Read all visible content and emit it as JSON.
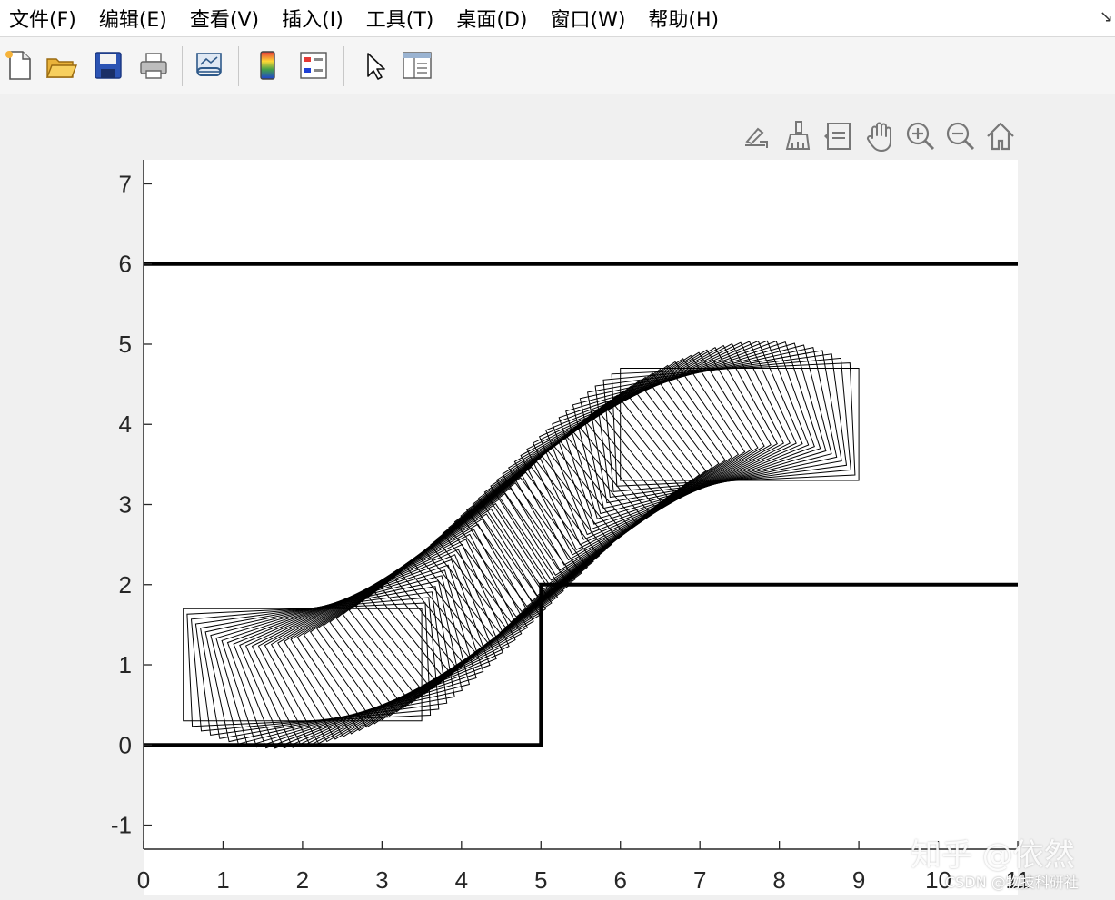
{
  "menu": {
    "items": [
      {
        "label": "文件(F)"
      },
      {
        "label": "编辑(E)"
      },
      {
        "label": "查看(V)"
      },
      {
        "label": "插入(I)"
      },
      {
        "label": "工具(T)"
      },
      {
        "label": "桌面(D)"
      },
      {
        "label": "窗口(W)"
      },
      {
        "label": "帮助(H)"
      }
    ],
    "corner_icon": "dock-arrow-icon"
  },
  "toolbar": {
    "buttons": [
      "new-figure-icon",
      "open-file-icon",
      "save-icon",
      "print-icon",
      "link-plot-icon",
      "colorbar-icon",
      "legend-icon",
      "edit-plot-arrow-icon",
      "property-inspector-icon"
    ]
  },
  "figure_tools": {
    "buttons": [
      "export-icon",
      "brush-icon",
      "data-tips-icon",
      "pan-hand-icon",
      "zoom-in-icon",
      "zoom-out-icon",
      "home-icon"
    ]
  },
  "watermark": {
    "text": "知乎 @依然",
    "subtext": "CSDN @物技科研社"
  },
  "chart_data": {
    "type": "line",
    "title": "",
    "xlabel": "",
    "ylabel": "",
    "xlim": [
      0,
      11
    ],
    "ylim": [
      -1.3,
      7.3
    ],
    "xticks": [
      0,
      1,
      2,
      3,
      4,
      5,
      6,
      7,
      8,
      9,
      10,
      11
    ],
    "yticks": [
      -1,
      0,
      1,
      2,
      3,
      4,
      5,
      6,
      7
    ],
    "xtick_labels": [
      "0",
      "1",
      "2",
      "3",
      "4",
      "5",
      "6",
      "7",
      "8",
      "9",
      "10",
      "11"
    ],
    "ytick_labels": [
      "-1",
      "0",
      "1",
      "2",
      "3",
      "4",
      "5",
      "6",
      "7"
    ],
    "grid": false,
    "series": [
      {
        "role": "upper-boundary",
        "points": [
          [
            0,
            6
          ],
          [
            11,
            6
          ]
        ]
      },
      {
        "role": "lower-boundary-step",
        "points": [
          [
            0,
            0
          ],
          [
            5,
            0
          ],
          [
            5,
            2
          ],
          [
            11,
            2
          ]
        ]
      }
    ],
    "vehicle_trace": {
      "start_center": [
        2,
        1
      ],
      "end_center": [
        7.5,
        4
      ],
      "length": 3,
      "width": 1.4,
      "frames": 70,
      "start_box": {
        "x": [
          0.5,
          3.5
        ],
        "y": [
          0.3,
          1.7
        ]
      },
      "end_box": {
        "x": [
          6,
          9
        ],
        "y": [
          3.3,
          4.7
        ]
      }
    }
  }
}
